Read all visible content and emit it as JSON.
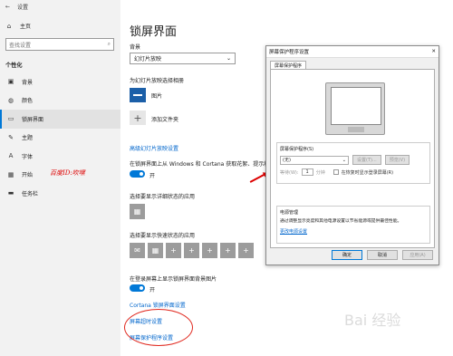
{
  "titlebar": {
    "back": "←",
    "title": "设置"
  },
  "sidebar": {
    "home": "主页",
    "search_placeholder": "查找设置",
    "section": "个性化",
    "items": [
      {
        "icon": "▣",
        "label": "背景"
      },
      {
        "icon": "◍",
        "label": "颜色"
      },
      {
        "icon": "▭",
        "label": "锁屏界面"
      },
      {
        "icon": "✎",
        "label": "主题"
      },
      {
        "icon": "A",
        "label": "字体"
      },
      {
        "icon": "▦",
        "label": "开始"
      },
      {
        "icon": "▬",
        "label": "任务栏"
      }
    ]
  },
  "main": {
    "title": "锁屏界面",
    "background_label": "背景",
    "background_value": "幻灯片放映",
    "album_label": "为幻灯片放映选择相册",
    "album_pictures": "图片",
    "album_add": "添加文件夹",
    "advanced_link": "高级幻灯片放映设置",
    "fun_facts": "在锁屏界面上从 Windows 和 Cortana 获取花絮、提示和",
    "toggle1": "开",
    "detailed_label": "选择要显示详细状态的应用",
    "quick_label": "选择要显示快速状态的应用",
    "signin_bg": "在登录屏幕上显示锁屏界面背景图片",
    "toggle2": "开",
    "cortana_link": "Cortana 锁屏界面设置",
    "timeout_link": "屏幕超时设置",
    "saver_link": "屏幕保护程序设置",
    "watermark": "百度ID:吹嘿"
  },
  "dialog": {
    "title": "屏幕保护程序设置",
    "tab": "屏幕保护程序",
    "saver_group": "屏幕保护程序(S)",
    "saver_value": "(无)",
    "settings_btn": "设置(T)...",
    "preview_btn": "预览(V)",
    "wait_label": "等待(W):",
    "wait_value": "1",
    "wait_unit": "分钟",
    "resume_label": "在恢复时显示登录屏幕(R)",
    "power_group": "电源管理",
    "power_desc": "通过调整显示亮度和其他电源设置以节省能源或提供最佳性能。",
    "power_link": "更改电源设置",
    "ok": "确定",
    "cancel": "取消",
    "apply": "应用(A)"
  },
  "watermark2": "Bai 经验"
}
